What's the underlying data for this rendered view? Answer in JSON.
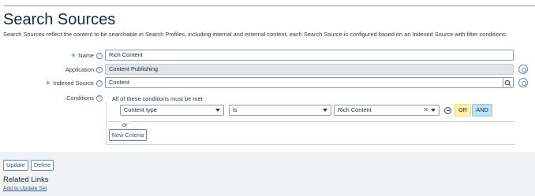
{
  "page": {
    "title": "Search Sources",
    "description": "Search Sources reflect the content to be searchable in Search Profiles, including internal and external content, each Search Source is configured based on an Indexed Source with filter conditions."
  },
  "form": {
    "name": {
      "label": "Name",
      "value": "Rich Content",
      "mandatory": "✳"
    },
    "application": {
      "label": "Application",
      "value": "Content Publishing"
    },
    "indexed_source": {
      "label": "Indexed Source",
      "value": "Content",
      "mandatory": "✳"
    },
    "conditions": {
      "label": "Conditions",
      "header": "All of these conditions must be met",
      "field": "Content type",
      "operator": "is",
      "value": "Rich Content",
      "clear_glyph": "✕",
      "or_label": "OR",
      "and_label": "AND",
      "separator": "or",
      "new_criteria": "New Criteria"
    },
    "help_glyph": "?"
  },
  "actions": {
    "update": "Update",
    "delete": "Delete"
  },
  "related": {
    "title": "Related Links",
    "link": "Add to Update Set"
  },
  "colors": {
    "or_button": "#fff2a8",
    "and_button": "#bfe3f5",
    "link": "#2e5d8b",
    "mandatory": "#2e7d9a"
  }
}
